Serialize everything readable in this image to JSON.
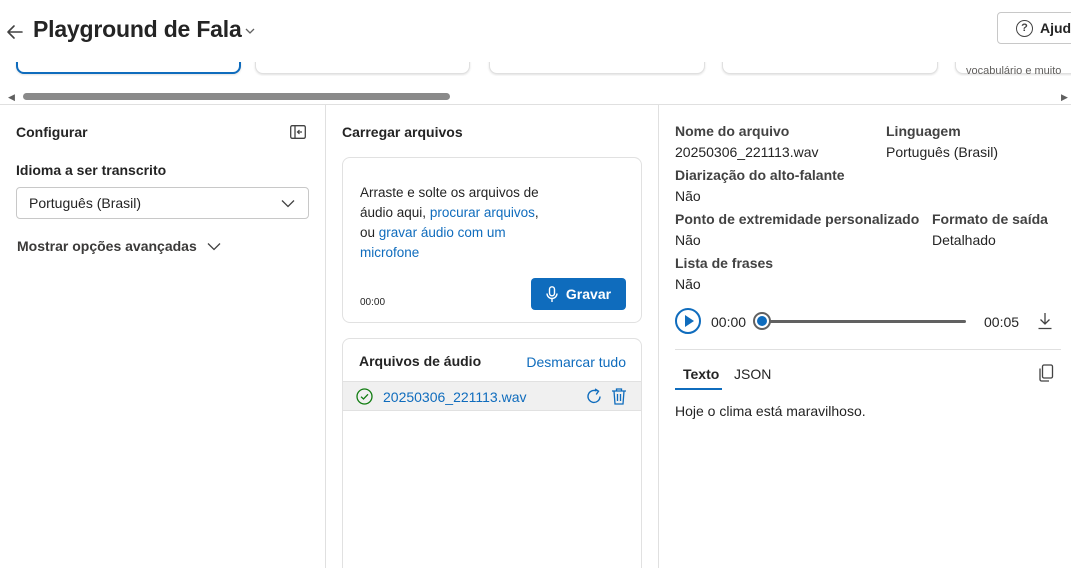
{
  "header": {
    "title": "Playground de Fala",
    "help_label": "Ajuda"
  },
  "scenario_cards": {
    "partial_text": "vocabulário e muito"
  },
  "left_panel": {
    "title": "Configurar",
    "language_label": "Idioma a ser transcrito",
    "language_value": "Português (Brasil)",
    "advanced_label": "Mostrar opções avançadas"
  },
  "middle_panel": {
    "title": "Carregar arquivos",
    "dropzone": {
      "text_prefix": "Arraste e solte os arquivos de áudio aqui,",
      "browse_link": "procurar arquivos",
      "text_or": ", ou",
      "record_link": "gravar áudio com um microfone",
      "timer": "00:00",
      "record_button": "Gravar"
    },
    "files": {
      "title": "Arquivos de áudio",
      "deselect_label": "Desmarcar tudo",
      "items": [
        {
          "name": "20250306_221113.wav"
        }
      ]
    }
  },
  "right_panel": {
    "file_name_label": "Nome do arquivo",
    "file_name_value": "20250306_221113.wav",
    "language_label": "Linguagem",
    "language_value": "Português (Brasil)",
    "diarization_label": "Diarização do alto-falante",
    "diarization_value": "Não",
    "endpoint_label": "Ponto de extremidade personalizado",
    "endpoint_value": "Não",
    "output_format_label": "Formato de saída",
    "output_format_value": "Detalhado",
    "phrase_list_label": "Lista de frases",
    "phrase_list_value": "Não",
    "player": {
      "current_time": "00:00",
      "total_time": "00:05",
      "progress": 0
    },
    "tabs": [
      "Texto",
      "JSON"
    ],
    "active_tab": "Texto",
    "transcript": "Hoje o clima está maravilhoso."
  },
  "colors": {
    "accent": "#0f6cbd",
    "border": "#e0e0e0",
    "success": "#107c10"
  }
}
